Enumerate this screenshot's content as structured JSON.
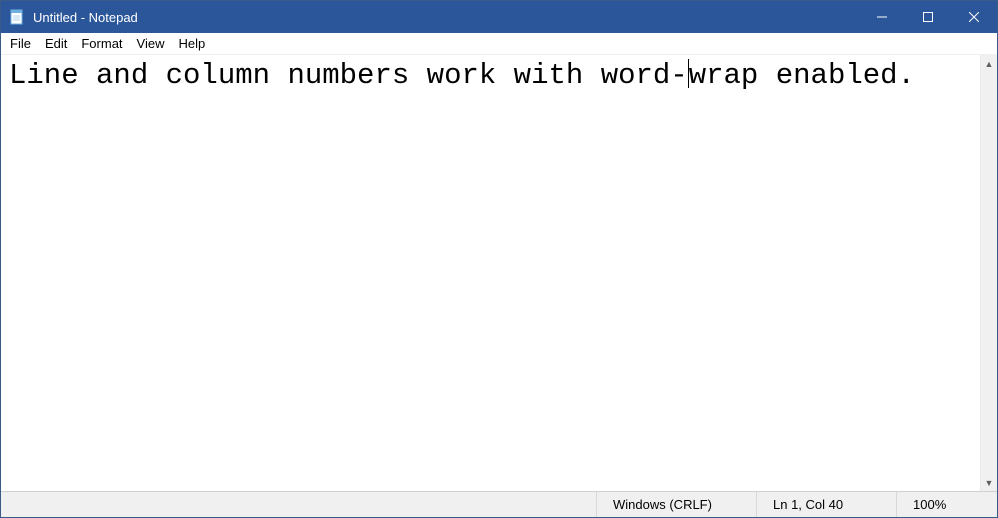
{
  "titlebar": {
    "title": "Untitled - Notepad"
  },
  "menubar": {
    "items": [
      "File",
      "Edit",
      "Format",
      "View",
      "Help"
    ]
  },
  "editor": {
    "text_before_caret": "Line and column numbers work with word-",
    "text_after_caret": "wrap enabled."
  },
  "statusbar": {
    "encoding": "Windows (CRLF)",
    "position": "Ln 1, Col 40",
    "zoom": "100%"
  }
}
